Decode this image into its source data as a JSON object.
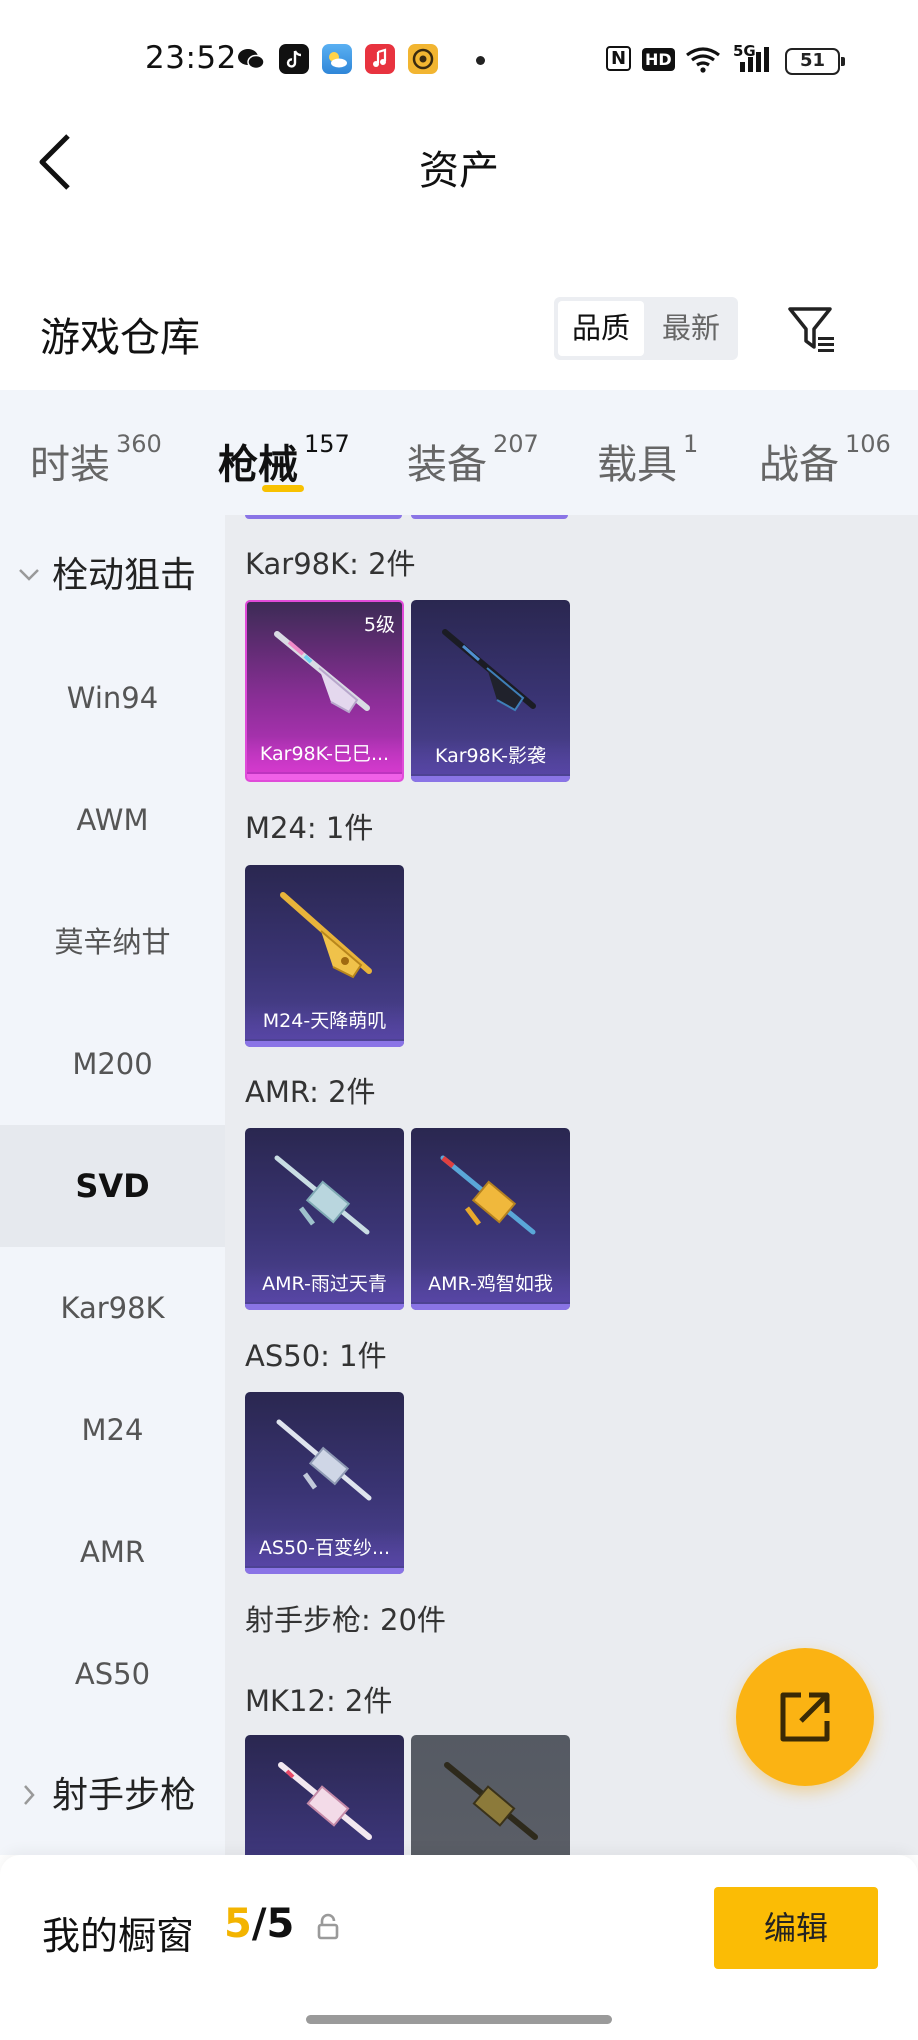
{
  "status_bar": {
    "time": "23:52",
    "network": "5G",
    "hd": "HD",
    "nfc": "N",
    "battery": "51"
  },
  "header": {
    "title": "资产"
  },
  "warehouse": {
    "title": "游戏仓库",
    "sort_options": [
      "品质",
      "最新"
    ],
    "active_sort": "品质"
  },
  "tabs": [
    {
      "label": "时装",
      "count": "360"
    },
    {
      "label": "枪械",
      "count": "157",
      "active": true
    },
    {
      "label": "装备",
      "count": "207"
    },
    {
      "label": "载具",
      "count": "1"
    },
    {
      "label": "战备",
      "count": "106"
    }
  ],
  "side_menu": {
    "group1": "栓动狙击",
    "items": [
      "Win94",
      "AWM",
      "莫辛纳甘",
      "M200",
      "SVD",
      "Kar98K",
      "M24",
      "AMR",
      "AS50"
    ],
    "selected": "SVD",
    "group2": "射手步枪"
  },
  "content": {
    "sections": [
      {
        "label": "Kar98K: 2件",
        "cards": [
          {
            "name": "Kar98K-巳巳...",
            "level": "5级",
            "rarity": "legendary"
          },
          {
            "name": "Kar98K-影袭",
            "rarity": "epic"
          }
        ]
      },
      {
        "label": "M24: 1件",
        "cards": [
          {
            "name": "M24-天降萌叽",
            "rarity": "epic"
          }
        ]
      },
      {
        "label": "AMR: 2件",
        "cards": [
          {
            "name": "AMR-雨过天青",
            "rarity": "epic"
          },
          {
            "name": "AMR-鸡智如我",
            "rarity": "epic"
          }
        ]
      },
      {
        "label": "AS50: 1件",
        "cards": [
          {
            "name": "AS50-百变纱...",
            "rarity": "epic"
          }
        ]
      }
    ],
    "category_label": "射手步枪: 20件",
    "mk12_label": "MK12: 2件"
  },
  "bottom_bar": {
    "label": "我的橱窗",
    "count_current": "5",
    "count_sep": "/",
    "count_total": "5",
    "edit_label": "编辑"
  },
  "colors": {
    "accent": "#fbbc05",
    "tab_underline": "#f8c100",
    "epic": "#8a74e6",
    "legendary": "#e04bd9"
  }
}
